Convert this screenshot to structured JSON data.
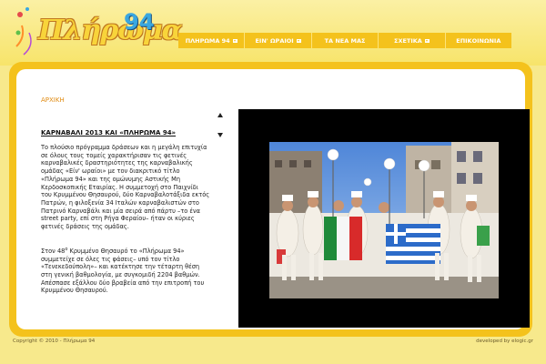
{
  "logo": {
    "text": "Πλήρωμα",
    "number": "94"
  },
  "nav": {
    "items": [
      {
        "label": "ΠΛΗΡΩΜΑ 94",
        "dropdown": true
      },
      {
        "label": "ΕΙΝ' ΩΡΑΙΟΙ",
        "dropdown": true
      },
      {
        "label": "ΤΑ ΝΕΑ ΜΑΣ",
        "dropdown": false
      },
      {
        "label": "ΣΧΕΤΙΚΑ",
        "dropdown": true
      },
      {
        "label": "ΕΠΙΚΟΙΝΩΝΙΑ",
        "dropdown": false
      }
    ]
  },
  "breadcrumb": "ΑΡΧΙΚΗ",
  "article": {
    "title": "ΚΑΡΝΑΒΑΛΙ 2013 ΚΑΙ «ΠΛΗΡΩΜΑ 94»",
    "paragraph1": "Το πλούσιο πρόγραμμα δράσεων και η μεγάλη επιτυχία σε όλους τους τομείς χαρακτήρισαν τις φετινές καρναβαλικές δραστηριότητες της καρναβαλικής ομάδας «Είν' ωραίοι» με τον διακριτικό τίτλο «Πλήρωμα 94» και της ομώνυμης Αστικής Μη Κερδοσκοπικής Εταιρίας. Η συμμετοχή στο Παιχνίδι του Κρυμμένου Θησαυρού, δύο Καρναβαλοτάξιδα εκτός Πατρών, η φιλοξενία 34 Ιταλών καρναβαλιστών στο Πατρινό Καρναβάλι και μία σειρά από πάρτυ –το ένα street party, επί στη Ρήγα Φεραίου– ήταν οι κύριες φετινές δράσεις της ομάδας.",
    "p2_prefix": "Στον 48",
    "p2_sup": "ο",
    "p2_rest": " Κρυμμένο Θησαυρό το «Πλήρωμα 94» συμμετείχε σε όλες τις φάσεις– υπό τον τίτλο «Τενεκεδούπολη»– και κατέκτησε την τέταρτη θέση στη γενική βαθμολογία, με συγκομιδή 2204 βαθμών. Απέσπασε εξάλλου δύο βραβεία από την επιτροπή του Κρυμμένου Θησαυρού."
  },
  "footer": {
    "copyright": "Copyright © 2010 - Πλήρωμα 94",
    "credit": "developed by elogic.gr"
  },
  "colors": {
    "accent": "#f4c21c",
    "background": "#f7e98c",
    "crumb": "#e08a10"
  }
}
